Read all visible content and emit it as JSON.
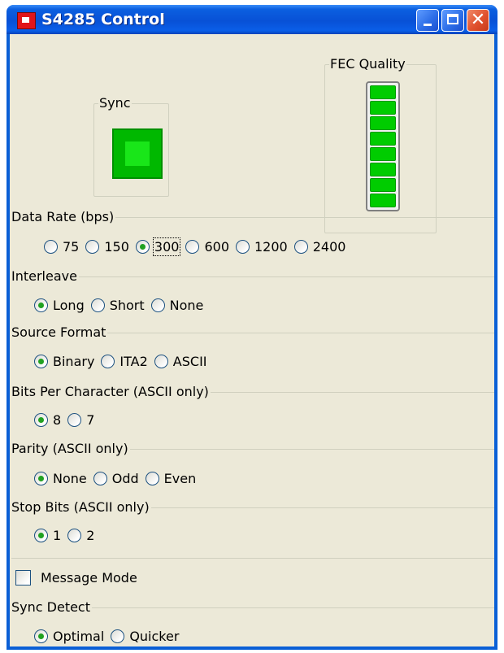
{
  "window": {
    "title": "S4285 Control",
    "buttons": {
      "minimize": "minimize",
      "maximize": "maximize",
      "close": "close"
    }
  },
  "indicators": {
    "sync": {
      "label": "Sync",
      "state": "on",
      "color": "#00c000"
    },
    "fec_quality": {
      "label": "FEC Quality",
      "segments_lit": 8,
      "segments_total": 8,
      "color": "#00cc00"
    }
  },
  "data_rate": {
    "label": "Data Rate (bps)",
    "options": [
      "75",
      "150",
      "300",
      "600",
      "1200",
      "2400"
    ],
    "selected": "300"
  },
  "interleave": {
    "label": "Interleave",
    "options": [
      "Long",
      "Short",
      "None"
    ],
    "selected": "Long"
  },
  "source_format": {
    "label": "Source Format",
    "options": [
      "Binary",
      "ITA2",
      "ASCII"
    ],
    "selected": "Binary"
  },
  "bits_per_char": {
    "label": "Bits Per Character  (ASCII only)",
    "options": [
      "8",
      "7"
    ],
    "selected": "8"
  },
  "parity": {
    "label": "Parity  (ASCII only)",
    "options": [
      "None",
      "Odd",
      "Even"
    ],
    "selected": "None"
  },
  "stop_bits": {
    "label": "Stop Bits  (ASCII only)",
    "options": [
      "1",
      "2"
    ],
    "selected": "1"
  },
  "message_mode": {
    "label": "Message Mode",
    "checked": false
  },
  "sync_detect": {
    "label": "Sync Detect",
    "options": [
      "Optimal",
      "Quicker"
    ],
    "selected": "Optimal"
  }
}
